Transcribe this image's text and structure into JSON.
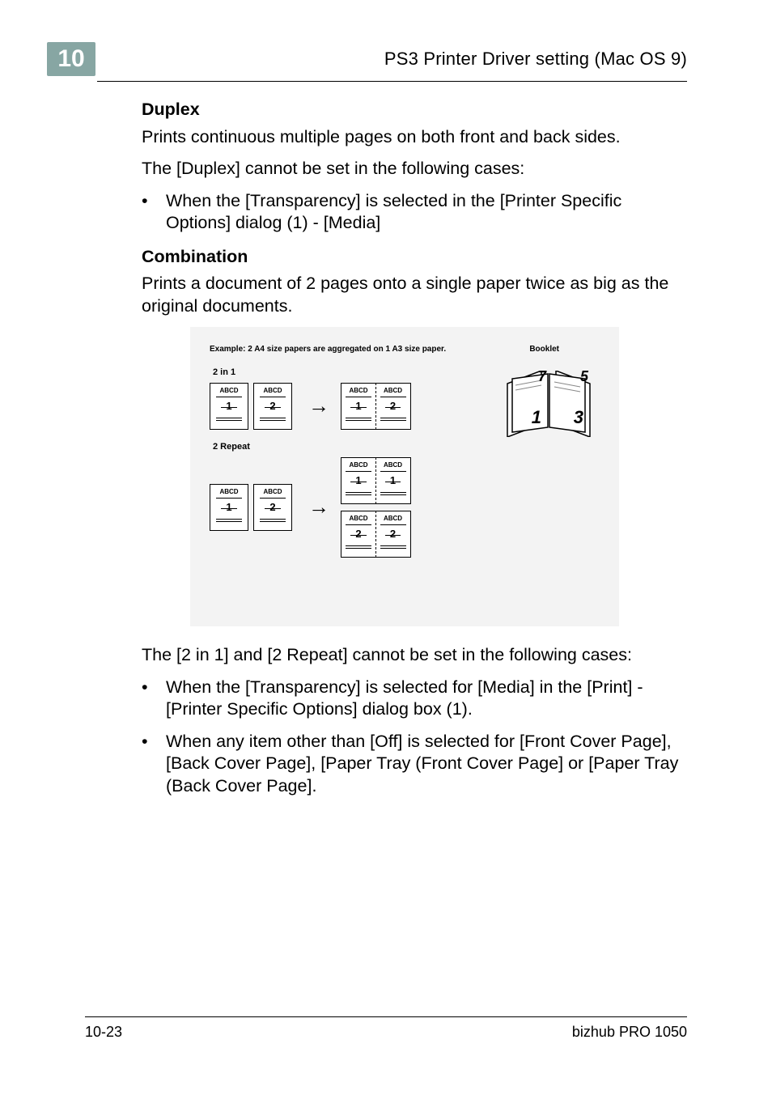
{
  "header": {
    "chapter": "10",
    "title": "PS3 Printer Driver setting (Mac OS 9)"
  },
  "sections": {
    "duplex": {
      "heading": "Duplex",
      "intro": "Prints continuous multiple pages on both front and back sides.",
      "note": "The [Duplex] cannot be set in the following cases:",
      "bullets": [
        "When the [Transparency] is selected in the [Printer Specific Options] dialog (1) - [Media]"
      ]
    },
    "combination": {
      "heading": "Combination",
      "intro": "Prints a document of 2 pages onto a single paper twice as big as the original documents.",
      "note": "The [2 in 1] and [2 Repeat] cannot be set in the following cases:",
      "bullets": [
        "When the [Transparency] is selected for [Media] in the [Print] - [Printer Specific Options] dialog box (1).",
        "When any item other than [Off] is selected for [Front Cover Page], [Back Cover Page], [Paper Tray (Front Cover Page] or [Paper Tray (Back Cover Page]."
      ]
    }
  },
  "figure": {
    "captionLeft": "Example: 2 A4 size papers are aggregated on 1 A3 size paper.",
    "captionRight": "Booklet",
    "label2in1": "2 in 1",
    "label2repeat": "2 Repeat",
    "abcd": "ABCD",
    "n1": "1",
    "n2": "2",
    "bookletLeft": "1",
    "bookletLeftBack": "7",
    "bookletRight": "3",
    "bookletRightBack": "5"
  },
  "footer": {
    "left": "10-23",
    "right": "bizhub PRO 1050"
  }
}
